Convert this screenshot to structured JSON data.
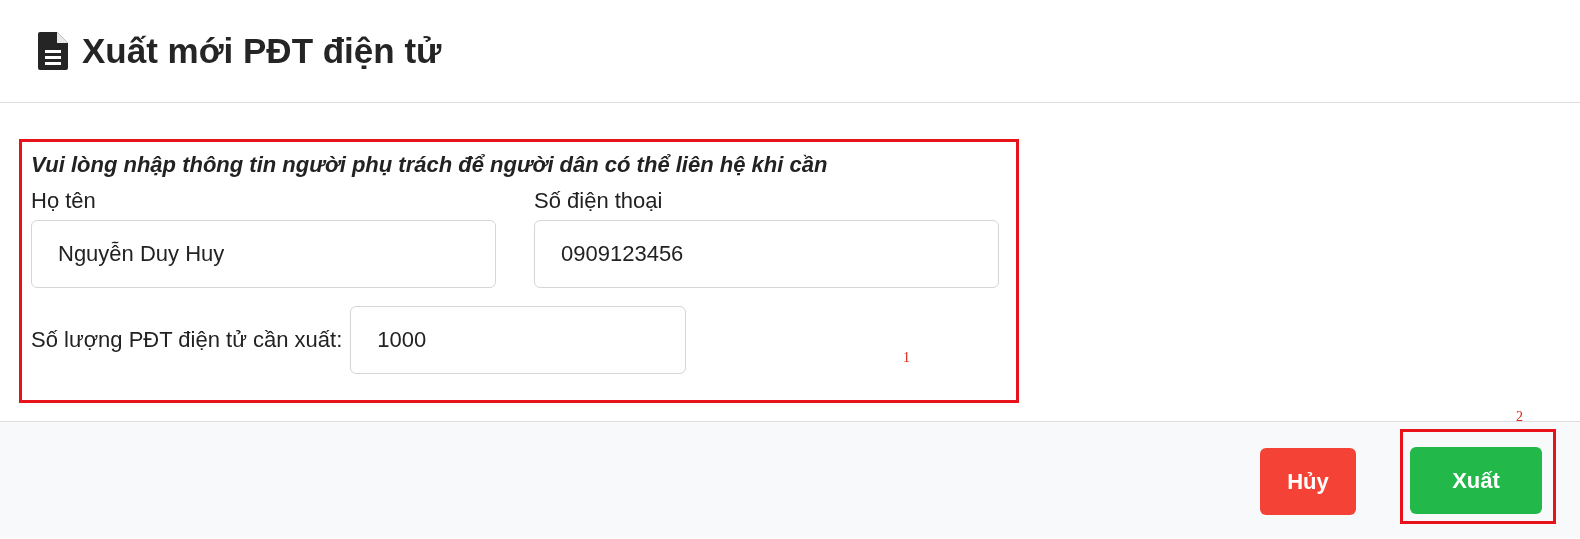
{
  "header": {
    "title": "Xuất mới PĐT điện tử"
  },
  "form": {
    "instruction": "Vui lòng nhập thông tin người phụ trách để người dân có thể liên hệ khi cần",
    "fields": [
      {
        "label": "Họ tên",
        "value": "Nguyễn Duy Huy"
      },
      {
        "label": "Số điện thoại",
        "value": "0909123456"
      },
      {
        "label": "Số lượng PĐT điện tử cần xuất:",
        "value": "1000"
      }
    ],
    "annotation": "1"
  },
  "footer": {
    "buttons": [
      {
        "label": "Hủy",
        "kind": "danger"
      },
      {
        "label": "Xuất",
        "kind": "primary",
        "annotation": "2"
      }
    ]
  }
}
